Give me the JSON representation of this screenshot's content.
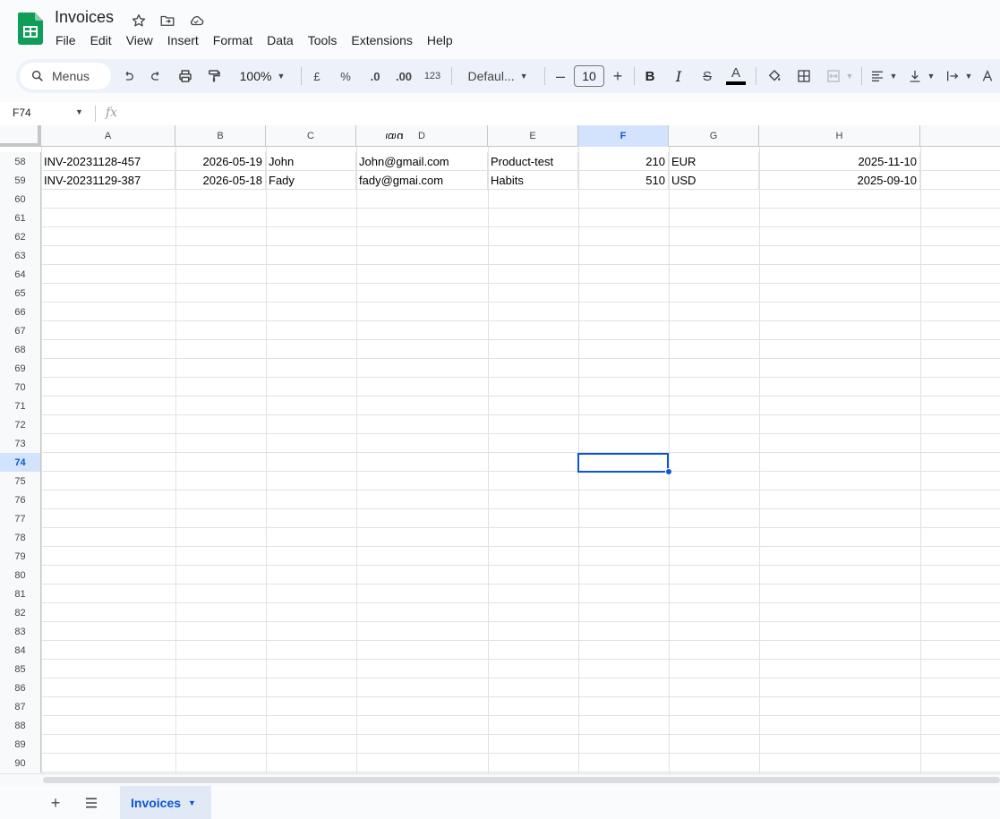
{
  "app": {
    "title": "Invoices",
    "brand_color": "#0f9d58",
    "accent_color": "#0b57d0"
  },
  "menus": [
    "File",
    "Edit",
    "View",
    "Insert",
    "Format",
    "Data",
    "Tools",
    "Extensions",
    "Help"
  ],
  "toolbar": {
    "search_label": "Menus",
    "zoom": "100%",
    "currency": "£",
    "percent": "%",
    "decrease_decimal": ".0",
    "increase_decimal": ".00",
    "number_format": "123",
    "font": "Defaul...",
    "font_size": "10",
    "minus": "–",
    "plus": "+",
    "bold": "B",
    "italic": "I",
    "strike": "S",
    "text_color": "A"
  },
  "formula_bar": {
    "name_box": "F74",
    "fx": "fx"
  },
  "grid": {
    "columns": [
      "A",
      "B",
      "C",
      "D",
      "E",
      "F",
      "G",
      "H"
    ],
    "active_column": "F",
    "clipped_text": "@g",
    "rows": [
      {
        "num": "58",
        "cells": [
          "INV-20231128-457",
          "2026-05-19",
          "John",
          "John@gmail.com",
          "Product-test",
          "210",
          "EUR",
          "2025-11-10"
        ]
      },
      {
        "num": "59",
        "cells": [
          "INV-20231129-387",
          "2026-05-18",
          "Fady",
          "fady@gmai.com",
          "Habits",
          "510",
          "USD",
          "2025-09-10"
        ]
      },
      {
        "num": "60",
        "cells": []
      },
      {
        "num": "61",
        "cells": []
      },
      {
        "num": "62",
        "cells": []
      },
      {
        "num": "63",
        "cells": []
      },
      {
        "num": "64",
        "cells": []
      },
      {
        "num": "65",
        "cells": []
      },
      {
        "num": "66",
        "cells": []
      },
      {
        "num": "67",
        "cells": []
      },
      {
        "num": "68",
        "cells": []
      },
      {
        "num": "69",
        "cells": []
      },
      {
        "num": "70",
        "cells": []
      },
      {
        "num": "71",
        "cells": []
      },
      {
        "num": "72",
        "cells": []
      },
      {
        "num": "73",
        "cells": []
      },
      {
        "num": "74",
        "cells": []
      },
      {
        "num": "75",
        "cells": []
      },
      {
        "num": "76",
        "cells": []
      },
      {
        "num": "77",
        "cells": []
      },
      {
        "num": "78",
        "cells": []
      },
      {
        "num": "79",
        "cells": []
      },
      {
        "num": "80",
        "cells": []
      },
      {
        "num": "81",
        "cells": []
      },
      {
        "num": "82",
        "cells": []
      },
      {
        "num": "83",
        "cells": []
      },
      {
        "num": "84",
        "cells": []
      },
      {
        "num": "85",
        "cells": []
      },
      {
        "num": "86",
        "cells": []
      },
      {
        "num": "87",
        "cells": []
      },
      {
        "num": "88",
        "cells": []
      },
      {
        "num": "89",
        "cells": []
      },
      {
        "num": "90",
        "cells": []
      }
    ],
    "active_row": "74"
  },
  "sheets": {
    "tabs": [
      {
        "label": "Invoices",
        "active": true
      }
    ]
  }
}
